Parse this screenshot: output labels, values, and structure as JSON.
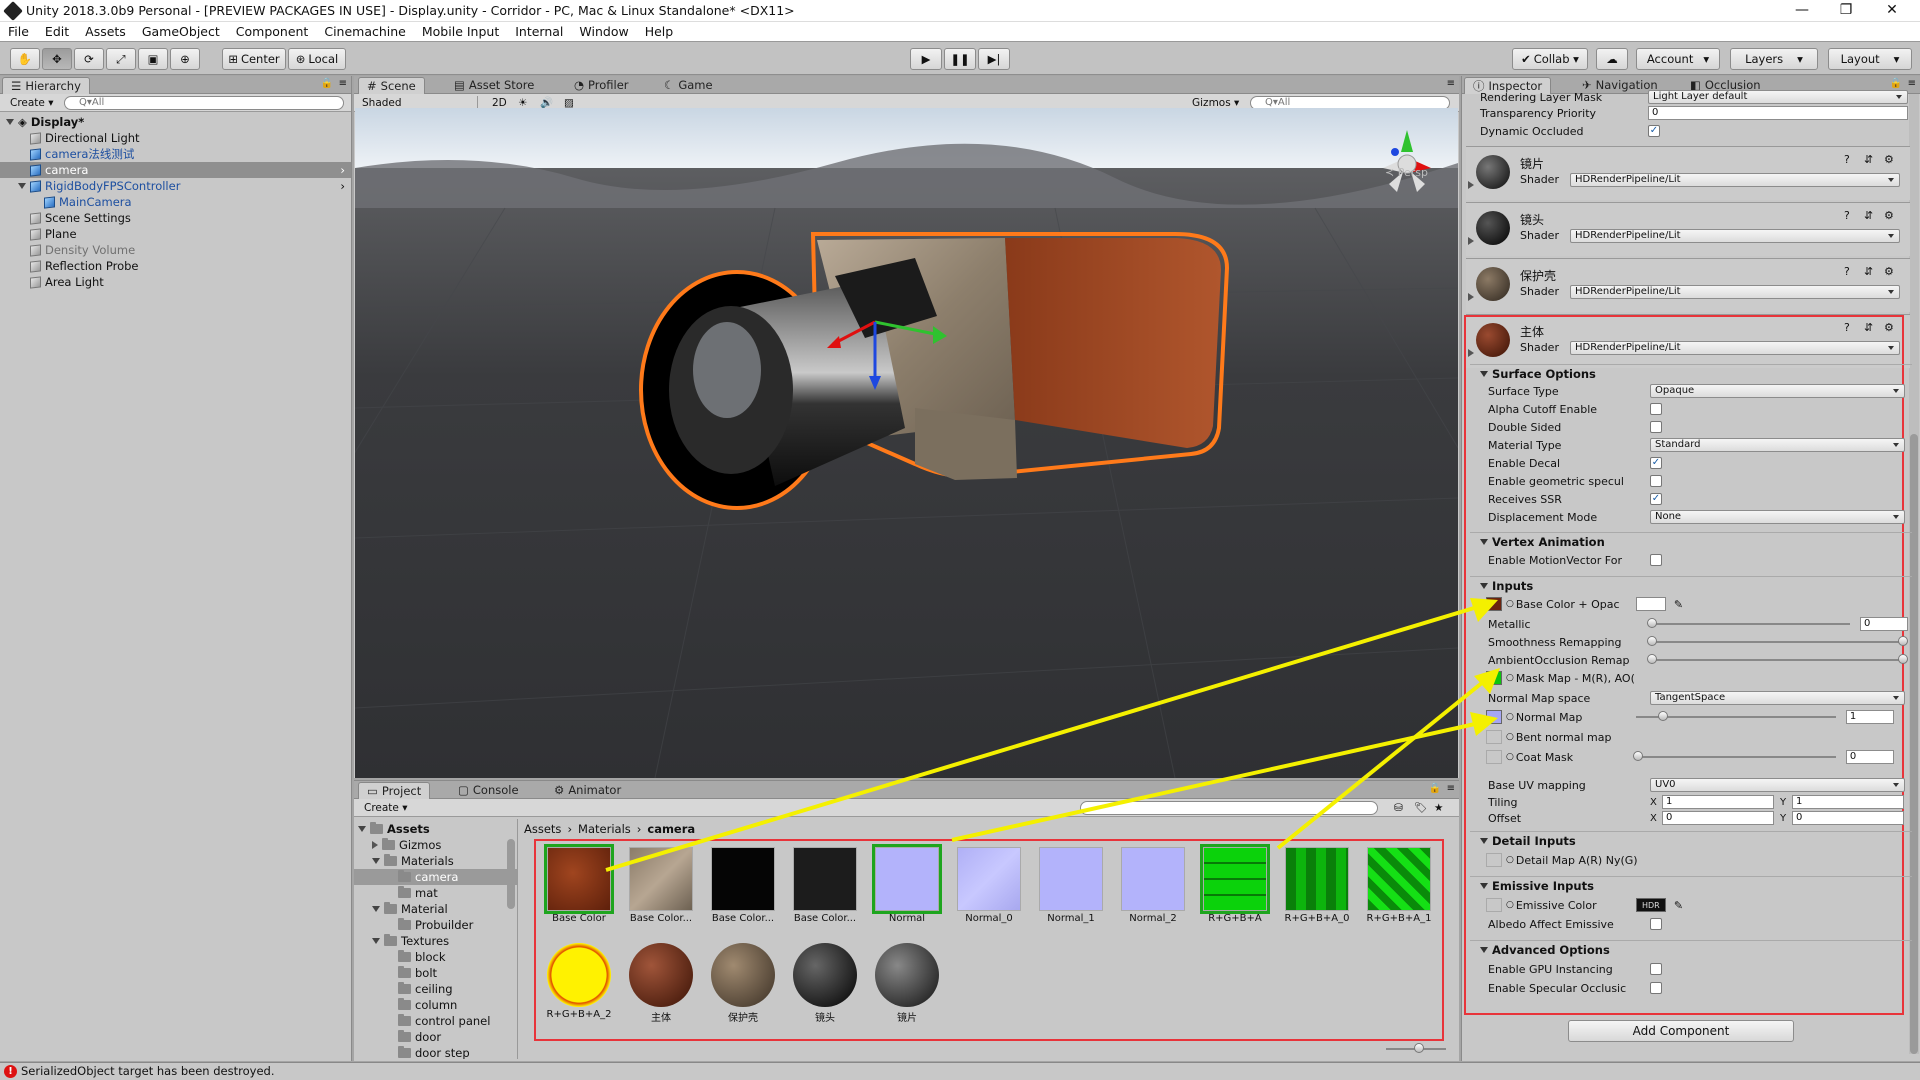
{
  "window": {
    "title": "Unity 2018.3.0b9 Personal - [PREVIEW PACKAGES IN USE] - Display.unity - Corridor - PC, Mac & Linux Standalone* <DX11>",
    "controls": [
      "—",
      "❐",
      "✕"
    ]
  },
  "menu": [
    "File",
    "Edit",
    "Assets",
    "GameObject",
    "Component",
    "Cinemachine",
    "Mobile Input",
    "Internal",
    "Window",
    "Help"
  ],
  "toolbar": {
    "center_label": "Center",
    "local_label": "Local",
    "collab_label": "Collab ▾",
    "account_label": "Account",
    "layers_label": "Layers",
    "layout_label": "Layout"
  },
  "hierarchy": {
    "tab": "Hierarchy",
    "create": "Create ▾",
    "search_placeholder": "Q▾All",
    "scene": "Display*",
    "items": [
      {
        "label": "Directional Light",
        "indent": 1,
        "style": "normal"
      },
      {
        "label": "camera法线测试",
        "indent": 1,
        "style": "prefab"
      },
      {
        "label": "camera",
        "indent": 1,
        "style": "selected"
      },
      {
        "label": "RigidBodyFPSController",
        "indent": 1,
        "style": "prefab"
      },
      {
        "label": "MainCamera",
        "indent": 2,
        "style": "prefab"
      },
      {
        "label": "Scene Settings",
        "indent": 1,
        "style": "normal"
      },
      {
        "label": "Plane",
        "indent": 1,
        "style": "normal"
      },
      {
        "label": "Density Volume",
        "indent": 1,
        "style": "disabled"
      },
      {
        "label": "Reflection Probe",
        "indent": 1,
        "style": "normal"
      },
      {
        "label": "Area Light",
        "indent": 1,
        "style": "normal"
      }
    ]
  },
  "scene": {
    "tabs": [
      "Scene",
      "Asset Store",
      "Profiler",
      "Game"
    ],
    "shading": "Shaded",
    "mode2d": "2D",
    "gizmos": "Gizmos ▾",
    "search_placeholder": "Q▾All",
    "persp": "≺ Persp"
  },
  "project": {
    "tabs": [
      "Project",
      "Console",
      "Animator"
    ],
    "create": "Create ▾",
    "breadcrumb": [
      "Assets",
      "Materials",
      "camera"
    ],
    "tree": [
      {
        "label": "Assets",
        "indent": 0,
        "bold": true,
        "expanded": true
      },
      {
        "label": "Gizmos",
        "indent": 1,
        "expanded": false
      },
      {
        "label": "Materials",
        "indent": 1,
        "expanded": true
      },
      {
        "label": "camera",
        "indent": 2,
        "selected": true
      },
      {
        "label": "mat",
        "indent": 2
      },
      {
        "label": "Material",
        "indent": 1,
        "expanded": true
      },
      {
        "label": "Probuilder",
        "indent": 2
      },
      {
        "label": "Textures",
        "indent": 1,
        "expanded": true
      },
      {
        "label": "block",
        "indent": 2
      },
      {
        "label": "bolt",
        "indent": 2
      },
      {
        "label": "ceiling",
        "indent": 2
      },
      {
        "label": "column",
        "indent": 2
      },
      {
        "label": "control panel",
        "indent": 2
      },
      {
        "label": "door",
        "indent": 2
      },
      {
        "label": "door step",
        "indent": 2
      }
    ],
    "assets": [
      {
        "name": "Base Color",
        "kind": "rust",
        "highlight": true
      },
      {
        "name": "Base Color...",
        "kind": "wood"
      },
      {
        "name": "Base Color...",
        "kind": "black"
      },
      {
        "name": "Base Color...",
        "kind": "dark"
      },
      {
        "name": "Normal",
        "kind": "normal",
        "highlight": true
      },
      {
        "name": "Normal_0",
        "kind": "normal2"
      },
      {
        "name": "Normal_1",
        "kind": "normal"
      },
      {
        "name": "Normal_2",
        "kind": "normal"
      },
      {
        "name": "R+G+B+A",
        "kind": "green",
        "highlight": true
      },
      {
        "name": "R+G+B+A_0",
        "kind": "green2"
      },
      {
        "name": "R+G+B+A_1",
        "kind": "green3"
      },
      {
        "name": "R+G+B+A_2",
        "kind": "yellow"
      },
      {
        "name": "主体",
        "kind": "ball-rust"
      },
      {
        "name": "保护壳",
        "kind": "ball-wood"
      },
      {
        "name": "镜头",
        "kind": "ball-black"
      },
      {
        "name": "镜片",
        "kind": "ball-dark"
      }
    ]
  },
  "inspector": {
    "tabs": [
      "Inspector",
      "Navigation",
      "Occlusion"
    ],
    "top_rows": [
      {
        "label": "Rendering Layer Mask",
        "value": "Light Layer default",
        "type": "dropdown"
      },
      {
        "label": "Transparency Priority",
        "value": "0",
        "type": "field"
      },
      {
        "label": "Dynamic Occluded",
        "value": "✓",
        "type": "check"
      }
    ],
    "materials": [
      {
        "name": "镜片",
        "shader_label": "Shader",
        "shader": "HDRenderPipeline/Lit",
        "ball": "dark"
      },
      {
        "name": "镜头",
        "shader_label": "Shader",
        "shader": "HDRenderPipeline/Lit",
        "ball": "black"
      },
      {
        "name": "保护壳",
        "shader_label": "Shader",
        "shader": "HDRenderPipeline/Lit",
        "ball": "wood"
      },
      {
        "name": "主体",
        "shader_label": "Shader",
        "shader": "HDRenderPipeline/Lit",
        "ball": "rust"
      }
    ],
    "surface_options": {
      "title": "Surface Options",
      "rows": [
        {
          "label": "Surface Type",
          "type": "dropdown",
          "value": "Opaque"
        },
        {
          "label": "Alpha Cutoff Enable",
          "type": "check",
          "value": ""
        },
        {
          "label": "Double Sided",
          "type": "check",
          "value": ""
        },
        {
          "label": "Material Type",
          "type": "dropdown",
          "value": "Standard"
        },
        {
          "label": "Enable Decal",
          "type": "check",
          "value": "✓"
        },
        {
          "label": "Enable geometric specul",
          "type": "check",
          "value": ""
        },
        {
          "label": "Receives SSR",
          "type": "check",
          "value": "✓"
        },
        {
          "label": "Displacement Mode",
          "type": "dropdown",
          "value": "None"
        }
      ]
    },
    "vertex_animation": {
      "title": "Vertex Animation",
      "rows": [
        {
          "label": "Enable MotionVector For",
          "type": "check",
          "value": ""
        }
      ]
    },
    "inputs": {
      "title": "Inputs",
      "base_color": "Base Color + Opac",
      "metallic": "Metallic",
      "metallic_value": "0",
      "smoothness": "Smoothness Remapping",
      "ao": "AmbientOcclusion Remap",
      "mask_map": "Mask Map - M(R), AO(",
      "normal_space": "Normal Map space",
      "normal_space_value": "TangentSpace",
      "normal_map": "Normal Map",
      "normal_value": "1",
      "bent_normal": "Bent normal map",
      "coat_mask": "Coat Mask",
      "coat_value": "0",
      "base_uv": "Base UV mapping",
      "base_uv_value": "UV0",
      "tiling": "Tiling",
      "offset": "Offset",
      "tiling_x": "1",
      "tiling_y": "1",
      "offset_x": "0",
      "offset_y": "0",
      "x_label": "X",
      "y_label": "Y"
    },
    "detail_inputs": {
      "title": "Detail Inputs",
      "detail_map": "Detail Map A(R) Ny(G)"
    },
    "emissive_inputs": {
      "title": "Emissive Inputs",
      "emissive_color": "Emissive Color",
      "hdr": "HDR",
      "albedo_affect": "Albedo Affect Emissive"
    },
    "advanced_options": {
      "title": "Advanced Options",
      "gpu_instancing": "Enable GPU Instancing",
      "specular_occlusion": "Enable Specular Occlusic"
    },
    "add_component": "Add Component"
  },
  "status": {
    "message": "SerializedObject target has been destroyed.",
    "icon": "error-icon"
  },
  "colors": {
    "highlight_red": "#e8343a",
    "arrow_yellow": "#f4f000",
    "selection_outline": "#ff7a1a",
    "accent_green": "#1ea51e"
  }
}
